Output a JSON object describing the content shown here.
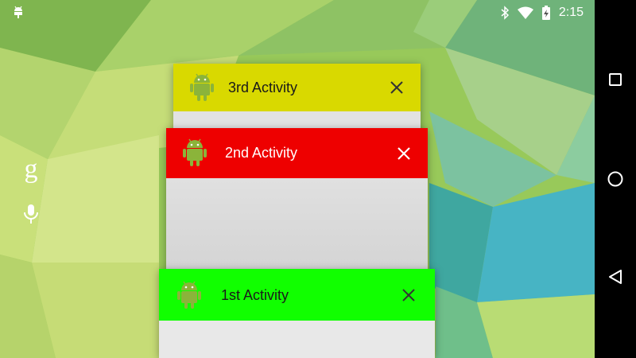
{
  "status_bar": {
    "time": "2:15",
    "icons": [
      "android-debug-icon",
      "bluetooth-icon",
      "wifi-icon",
      "battery-charging-icon"
    ]
  },
  "home_widgets": {
    "search_logo": "g",
    "voice_icon": "mic-icon"
  },
  "recent_apps": [
    {
      "title": "3rd Activity",
      "header_color": "#d9d900",
      "icon": "android-icon",
      "dismiss_icon": "close-icon"
    },
    {
      "title": "2nd Activity",
      "header_color": "#ee0000",
      "icon": "android-icon",
      "dismiss_icon": "close-icon"
    },
    {
      "title": "1st Activity",
      "header_color": "#11ff00",
      "icon": "android-icon",
      "dismiss_icon": "close-icon"
    }
  ],
  "navigation_bar": {
    "buttons": [
      "recents-icon",
      "home-icon",
      "back-icon"
    ]
  }
}
